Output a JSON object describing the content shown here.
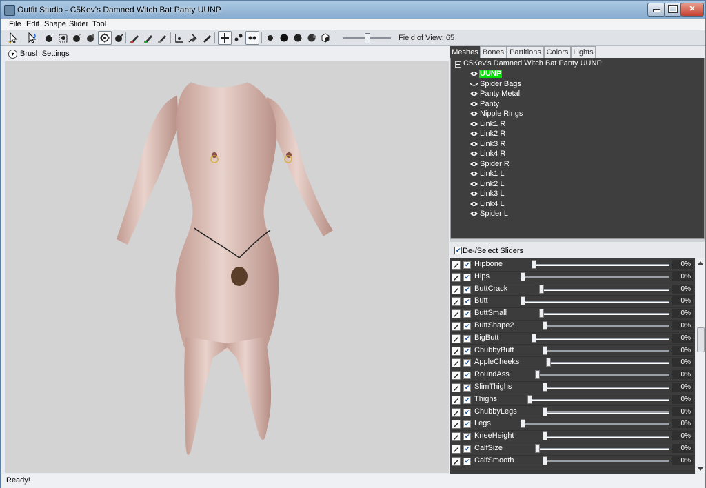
{
  "window": {
    "title": "Outfit Studio - C5Kev's Damned Witch Bat Panty UUNP"
  },
  "menu": [
    {
      "label": "File"
    },
    {
      "label": "Edit"
    },
    {
      "label": "Shape"
    },
    {
      "label": "Slider"
    },
    {
      "label": "Tool"
    }
  ],
  "toolbar": {
    "tools": [
      {
        "icon": "select-tool-icon"
      },
      {
        "icon": "transform-tool-icon"
      },
      {
        "icon": "inflate-brush-icon"
      },
      {
        "icon": "deflate-brush-icon"
      },
      {
        "icon": "move-brush-icon"
      },
      {
        "icon": "smooth-brush-icon"
      },
      {
        "icon": "mask-brush-icon"
      },
      {
        "icon": "unmask-brush-icon"
      },
      {
        "icon": "color-brush-icon"
      },
      {
        "icon": "alpha-brush-icon"
      },
      {
        "icon": "weight-brush-icon"
      },
      {
        "icon": "collapse-vertex-icon"
      },
      {
        "icon": "pin-icon"
      },
      {
        "icon": "pen-icon"
      },
      {
        "icon": "wireframe-icon"
      },
      {
        "icon": "vertex-points-icon"
      },
      {
        "icon": "mask-view-icon"
      },
      {
        "icon": "sphere-solid-icon"
      },
      {
        "icon": "sphere-dark-icon"
      },
      {
        "icon": "sphere-shaded-icon"
      },
      {
        "icon": "sphere-smooth-icon"
      },
      {
        "icon": "cube-icon"
      }
    ],
    "fov_label": "Field of View: 65",
    "fov_value": 65,
    "fov_fraction": 0.5
  },
  "brush_settings": {
    "label": "Brush Settings"
  },
  "tabs": [
    {
      "label": "Meshes",
      "active": true
    },
    {
      "label": "Bones",
      "active": false
    },
    {
      "label": "Partitions",
      "active": false
    },
    {
      "label": "Colors",
      "active": false
    },
    {
      "label": "Lights",
      "active": false
    }
  ],
  "meshes": {
    "root": "C5Kev's Damned Witch Bat Panty UUNP",
    "items": [
      {
        "label": "UUNP",
        "selected": true,
        "visible": true
      },
      {
        "label": "Spider Bags",
        "selected": false,
        "visible": false
      },
      {
        "label": "Panty Metal",
        "selected": false,
        "visible": true
      },
      {
        "label": "Panty",
        "selected": false,
        "visible": true
      },
      {
        "label": "Nipple Rings",
        "selected": false,
        "visible": true
      },
      {
        "label": "Link1 R",
        "selected": false,
        "visible": true
      },
      {
        "label": "Link2 R",
        "selected": false,
        "visible": true
      },
      {
        "label": "Link3 R",
        "selected": false,
        "visible": true
      },
      {
        "label": "Link4 R",
        "selected": false,
        "visible": true
      },
      {
        "label": "Spider R",
        "selected": false,
        "visible": true
      },
      {
        "label": "Link1 L",
        "selected": false,
        "visible": true
      },
      {
        "label": "Link2 L",
        "selected": false,
        "visible": true
      },
      {
        "label": "Link3 L",
        "selected": false,
        "visible": true
      },
      {
        "label": "Link4 L",
        "selected": false,
        "visible": true
      },
      {
        "label": "Spider L",
        "selected": false,
        "visible": true
      }
    ]
  },
  "sliders": {
    "header_label": "De-/Select Sliders",
    "items": [
      {
        "name": "Hipbone",
        "value": "0%",
        "fraction": 0.0
      },
      {
        "name": "Hips",
        "value": "0%",
        "fraction": 0.0
      },
      {
        "name": "ButtCrack",
        "value": "0%",
        "fraction": 0.0
      },
      {
        "name": "Butt",
        "value": "0%",
        "fraction": 0.0
      },
      {
        "name": "ButtSmall",
        "value": "0%",
        "fraction": 0.0
      },
      {
        "name": "ButtShape2",
        "value": "0%",
        "fraction": 0.0
      },
      {
        "name": "BigButt",
        "value": "0%",
        "fraction": 0.0
      },
      {
        "name": "ChubbyButt",
        "value": "0%",
        "fraction": 0.0
      },
      {
        "name": "AppleCheeks",
        "value": "0%",
        "fraction": 0.0
      },
      {
        "name": "RoundAss",
        "value": "0%",
        "fraction": 0.0
      },
      {
        "name": "SlimThighs",
        "value": "0%",
        "fraction": 0.0
      },
      {
        "name": "Thighs",
        "value": "0%",
        "fraction": 0.0
      },
      {
        "name": "ChubbyLegs",
        "value": "0%",
        "fraction": 0.0
      },
      {
        "name": "Legs",
        "value": "0%",
        "fraction": 0.0
      },
      {
        "name": "KneeHeight",
        "value": "0%",
        "fraction": 0.0
      },
      {
        "name": "CalfSize",
        "value": "0%",
        "fraction": 0.0
      },
      {
        "name": "CalfSmooth",
        "value": "0%",
        "fraction": 0.0
      }
    ]
  },
  "status": {
    "text": "Ready!"
  },
  "colors": {
    "selected_mesh": "#00e000",
    "dark_panel": "#3e3e3e",
    "viewport": "#d3d3d3"
  }
}
